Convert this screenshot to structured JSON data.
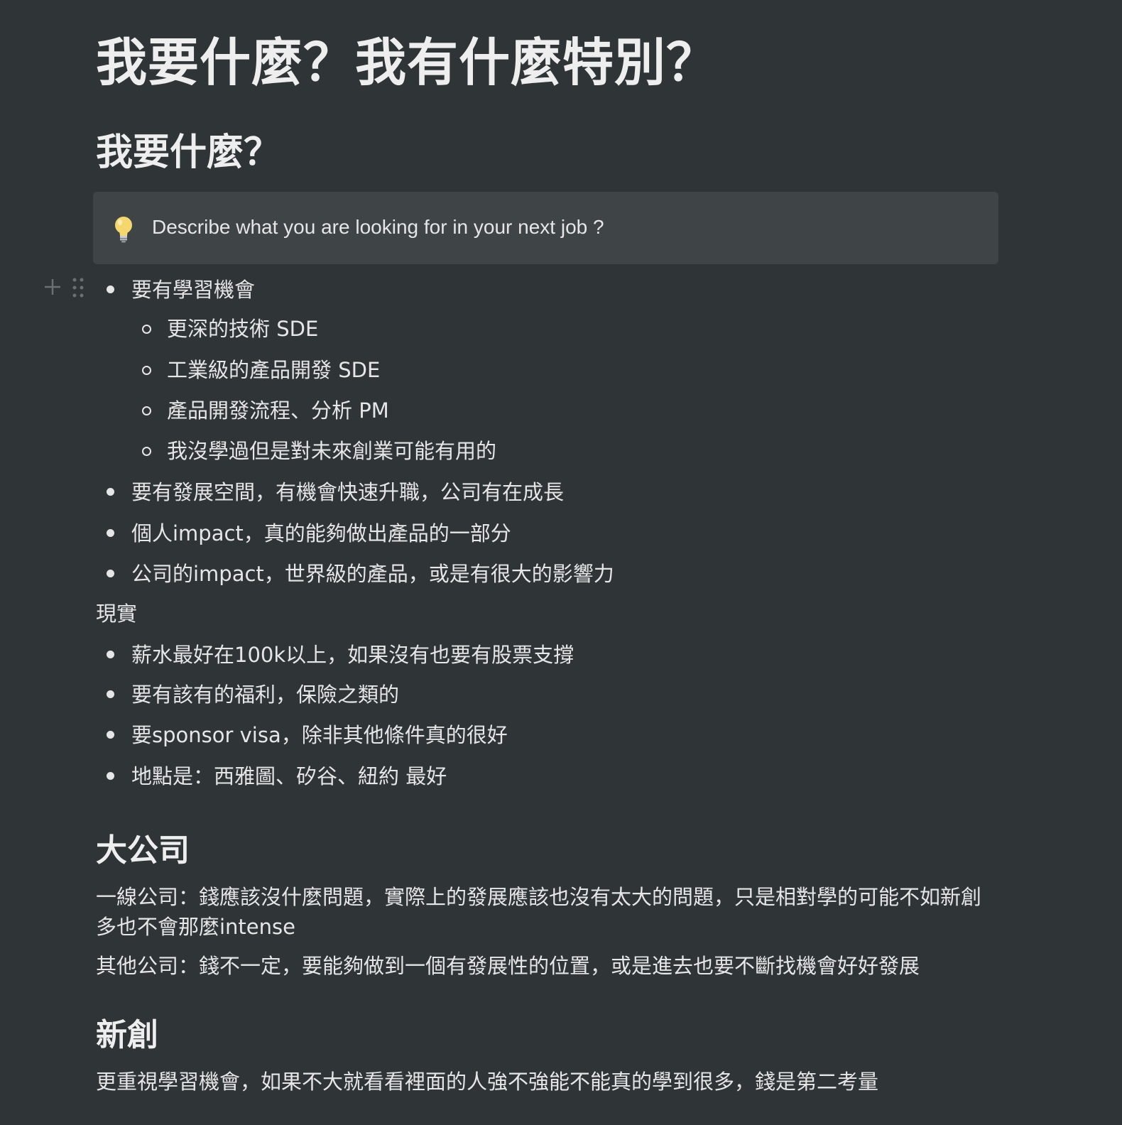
{
  "page_title": "我要什麼？我有什麼特別？",
  "section_want": {
    "heading": "我要什麼？",
    "callout": {
      "icon": "lightbulb-icon",
      "text": "Describe what you are looking for in your next job ?"
    },
    "list": [
      {
        "text": "要有學習機會",
        "children": [
          "更深的技術 SDE",
          "工業級的產品開發 SDE",
          "產品開發流程、分析 PM",
          "我沒學過但是對未來創業可能有用的"
        ]
      },
      {
        "text": "要有發展空間，有機會快速升職，公司有在成長"
      },
      {
        "text": "個人impact，真的能夠做出產品的一部分"
      },
      {
        "text": "公司的impact，世界級的產品，或是有很大的影響力"
      }
    ],
    "reality_label": "現實",
    "reality_list": [
      "薪水最好在100k以上，如果沒有也要有股票支撐",
      "要有該有的福利，保險之類的",
      "要sponsor visa，除非其他條件真的很好",
      "地點是：西雅圖、矽谷、紐約 最好"
    ]
  },
  "section_big_company": {
    "heading": "大公司",
    "paragraphs": [
      "一線公司：錢應該沒什麼問題，實際上的發展應該也沒有太大的問題，只是相對學的可能不如新創多也不會那麼intense",
      "其他公司：錢不一定，要能夠做到一個有發展性的位置，或是進去也要不斷找機會好好發展"
    ]
  },
  "section_startup": {
    "heading": "新創",
    "paragraphs": [
      "更重視學習機會，如果不大就看看裡面的人強不強能不能真的學到很多，錢是第二考量"
    ]
  },
  "colors": {
    "background": "#2f3437",
    "callout_bg": "#3f4447",
    "text": "#e6e6e6",
    "handle": "#6b7073"
  }
}
